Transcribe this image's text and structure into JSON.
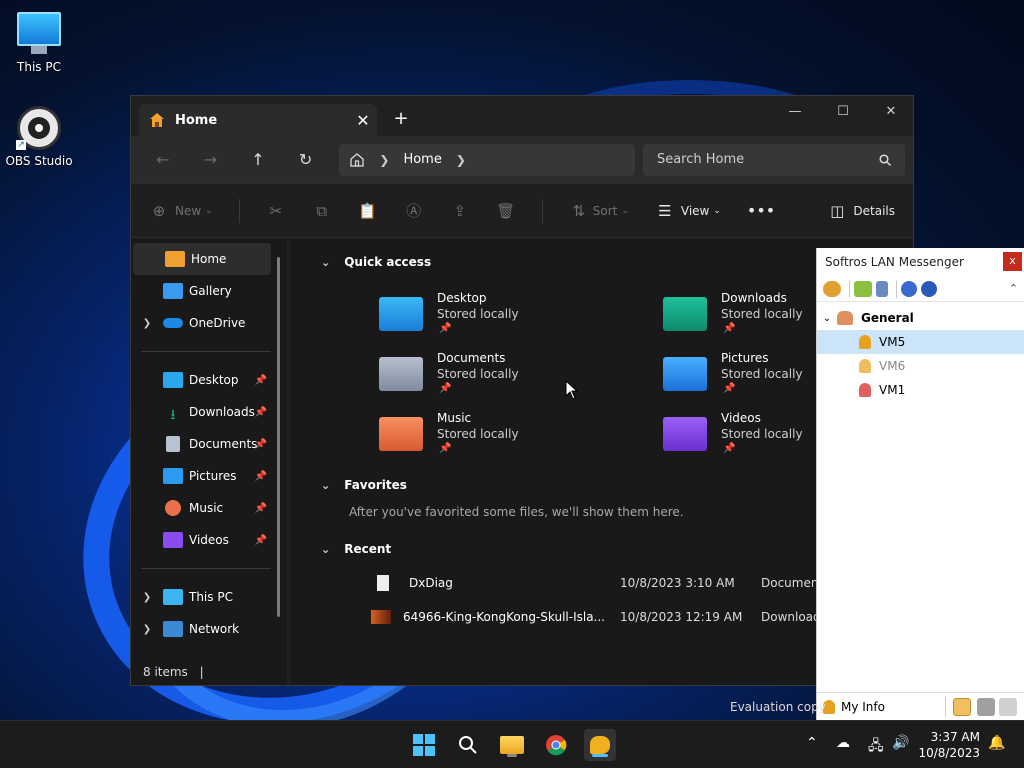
{
  "desktop": {
    "icons": [
      {
        "label": "This PC"
      },
      {
        "label": "OBS Studio"
      }
    ],
    "watermark": "Evaluation copy"
  },
  "explorer": {
    "tab_title": "Home",
    "address": {
      "segment": "Home"
    },
    "search_placeholder": "Search Home",
    "toolbar": {
      "new_label": "New",
      "sort_label": "Sort",
      "view_label": "View",
      "details_label": "Details"
    },
    "nav": {
      "home": "Home",
      "gallery": "Gallery",
      "onedrive": "OneDrive",
      "desktop": "Desktop",
      "downloads": "Downloads",
      "documents": "Documents",
      "pictures": "Pictures",
      "music": "Music",
      "videos": "Videos",
      "thispc": "This PC",
      "network": "Network"
    },
    "status": "8 items",
    "sections": {
      "quick_access": "Quick access",
      "favorites": "Favorites",
      "recent": "Recent"
    },
    "quick_access": [
      {
        "name": "Desktop",
        "sub": "Stored locally",
        "color": "#29a8f0"
      },
      {
        "name": "Downloads",
        "sub": "Stored locally",
        "color": "#17b08a"
      },
      {
        "name": "Documents",
        "sub": "Stored locally",
        "color": "#9aa6b8"
      },
      {
        "name": "Pictures",
        "sub": "Stored locally",
        "color": "#2a9bf0"
      },
      {
        "name": "Music",
        "sub": "Stored locally",
        "color": "#f07a4a"
      },
      {
        "name": "Videos",
        "sub": "Stored locally",
        "color": "#8a4cf0"
      }
    ],
    "favorites_empty": "After you've favorited some files, we'll show them here.",
    "recent": [
      {
        "name": "DxDiag",
        "date": "10/8/2023 3:10 AM",
        "location": "Document"
      },
      {
        "name": "64966-King-KongKong-Skull-Isla...",
        "date": "10/8/2023 12:19 AM",
        "location": "Downloads"
      }
    ]
  },
  "messenger": {
    "title": "Softros LAN Messenger",
    "close": "x",
    "group": "General",
    "users": [
      "VM5",
      "VM6",
      "VM1"
    ],
    "my_info": "My Info"
  },
  "taskbar": {
    "time": "3:37 AM",
    "date": "10/8/2023"
  }
}
